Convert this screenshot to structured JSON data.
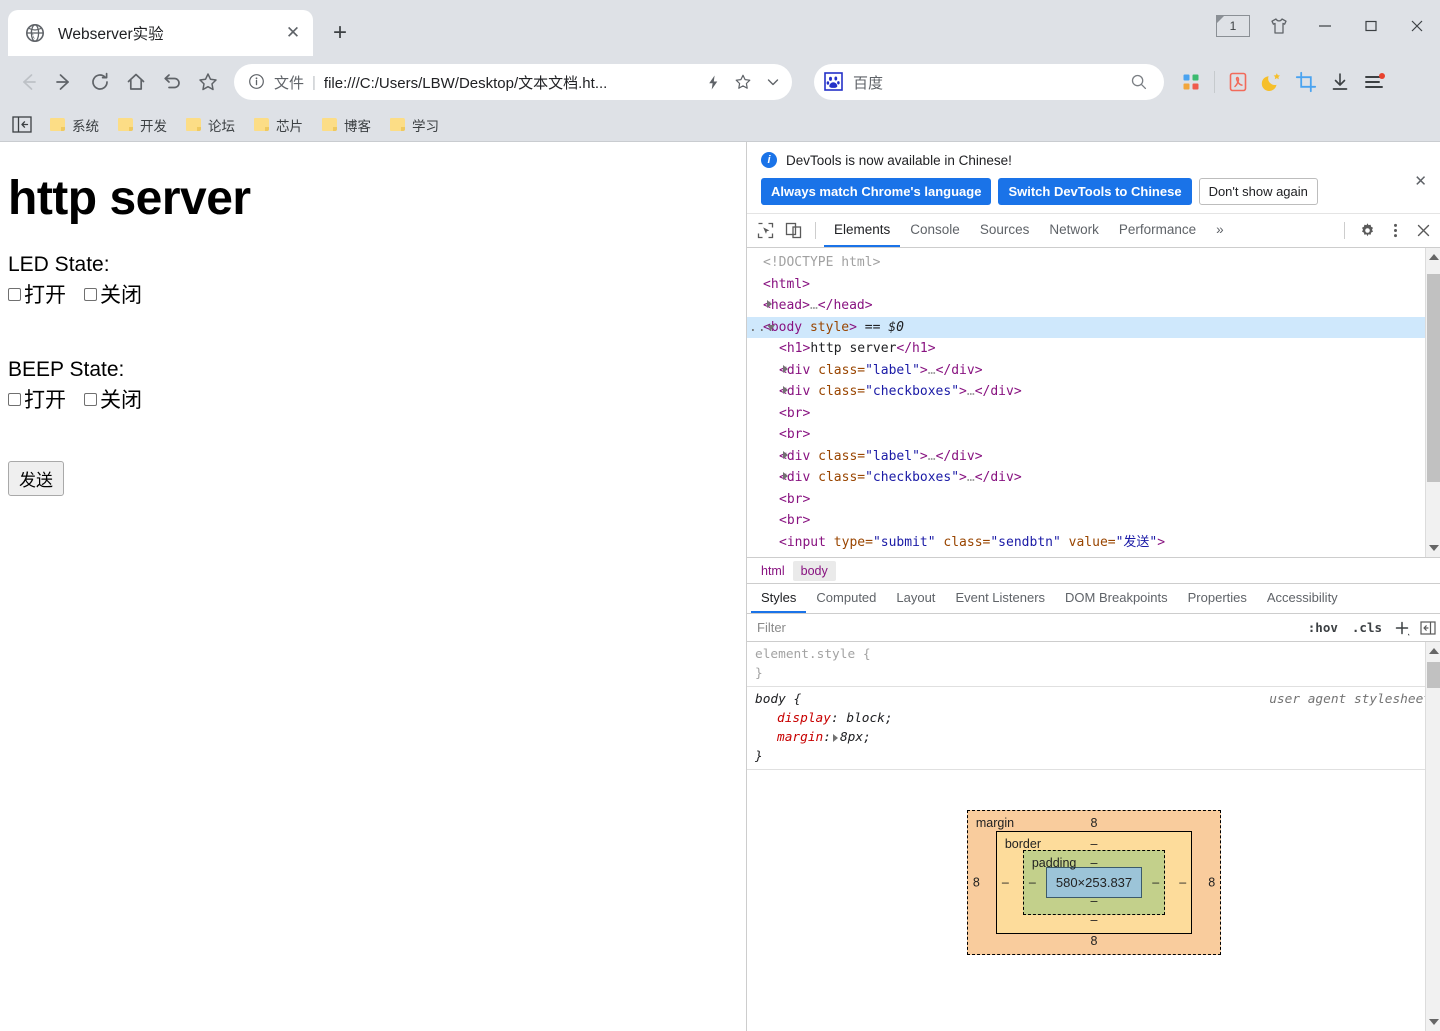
{
  "browser": {
    "tab": {
      "title": "Webserver实验",
      "favicon": "globe-icon",
      "close_label": "✕"
    },
    "newtab_label": "+",
    "window_controls": {
      "tab_count": "1",
      "theme_icon": "tshirt-icon",
      "minimize": "—",
      "maximize": "▢",
      "close": "✕"
    },
    "nav": {
      "back": "←",
      "forward": "→",
      "reload": "⟳",
      "home": "⌂",
      "history_back": "↺",
      "bookmark": "☆"
    },
    "omnibox": {
      "info_icon": "info-circle-icon",
      "scheme_label": "文件",
      "separator": "|",
      "url": "file:///C:/Users/LBW/Desktop/文本文档.ht...",
      "lightning_icon": "lightning-icon",
      "star_icon": "star-icon",
      "chevron_icon": "chevron-down-icon"
    },
    "search": {
      "engine_icon": "baidu-icon",
      "placeholder": "百度",
      "search_icon": "magnifier-icon"
    },
    "extensions": [
      "apps-grid-icon",
      "pdf-icon",
      "moon-star-icon",
      "crop-icon",
      "download-icon",
      "menu-lines-icon"
    ],
    "bookmarks": {
      "panel_toggle": "sidebar-toggle-icon",
      "items": [
        {
          "label": "系统"
        },
        {
          "label": "开发"
        },
        {
          "label": "论坛"
        },
        {
          "label": "芯片"
        },
        {
          "label": "博客"
        },
        {
          "label": "学习"
        }
      ]
    }
  },
  "page": {
    "heading": "http server",
    "groups": [
      {
        "label": "LED State:",
        "options": [
          {
            "label": "打开",
            "checked": false
          },
          {
            "label": "关闭",
            "checked": false
          }
        ]
      },
      {
        "label": "BEEP State:",
        "options": [
          {
            "label": "打开",
            "checked": false
          },
          {
            "label": "关闭",
            "checked": false
          }
        ]
      }
    ],
    "send_button": "发送"
  },
  "devtools": {
    "notice": {
      "icon": "info-icon",
      "message": "DevTools is now available in Chinese!",
      "buttons": [
        {
          "label": "Always match Chrome's language",
          "style": "primary"
        },
        {
          "label": "Switch DevTools to Chinese",
          "style": "primary"
        },
        {
          "label": "Don't show again",
          "style": "ghost"
        }
      ],
      "close": "✕"
    },
    "toolbar": {
      "inspect_icon": "inspect-cursor-icon",
      "device_icon": "device-toolbar-icon",
      "tabs": [
        {
          "label": "Elements",
          "active": true
        },
        {
          "label": "Console",
          "active": false
        },
        {
          "label": "Sources",
          "active": false
        },
        {
          "label": "Network",
          "active": false
        },
        {
          "label": "Performance",
          "active": false
        }
      ],
      "more_tabs": "»",
      "settings_icon": "gear-icon",
      "kebab_icon": "more-vertical-icon",
      "close_icon": "close-icon"
    },
    "dom_tree": [
      {
        "indent": 0,
        "arrow": "none",
        "marker": "",
        "selected": false,
        "parts": [
          {
            "t": "cmt",
            "s": "<!DOCTYPE html>"
          }
        ]
      },
      {
        "indent": 0,
        "arrow": "none",
        "marker": "",
        "selected": false,
        "parts": [
          {
            "t": "tag",
            "s": "<html>"
          }
        ]
      },
      {
        "indent": 0,
        "arrow": "right",
        "marker": "",
        "selected": false,
        "parts": [
          {
            "t": "tag",
            "s": "<head>"
          },
          {
            "t": "cmt",
            "s": "…"
          },
          {
            "t": "tag",
            "s": "</head>"
          }
        ]
      },
      {
        "indent": 0,
        "arrow": "down",
        "marker": "...",
        "selected": true,
        "parts": [
          {
            "t": "tag",
            "s": "<body"
          },
          {
            "t": "attr",
            "s": " style"
          },
          {
            "t": "tag",
            "s": ">"
          },
          {
            "t": "sel0",
            "s": " == $0"
          }
        ]
      },
      {
        "indent": 1,
        "arrow": "none",
        "marker": "",
        "selected": false,
        "parts": [
          {
            "t": "tag",
            "s": "<h1>"
          },
          {
            "t": "txt",
            "s": "http server"
          },
          {
            "t": "tag",
            "s": "</h1>"
          }
        ]
      },
      {
        "indent": 1,
        "arrow": "right",
        "marker": "",
        "selected": false,
        "parts": [
          {
            "t": "tag",
            "s": "<div "
          },
          {
            "t": "attr",
            "s": "class="
          },
          {
            "t": "val",
            "s": "\"label\""
          },
          {
            "t": "tag",
            "s": ">"
          },
          {
            "t": "cmt",
            "s": "…"
          },
          {
            "t": "tag",
            "s": "</div>"
          }
        ]
      },
      {
        "indent": 1,
        "arrow": "right",
        "marker": "",
        "selected": false,
        "parts": [
          {
            "t": "tag",
            "s": "<div "
          },
          {
            "t": "attr",
            "s": "class="
          },
          {
            "t": "val",
            "s": "\"checkboxes\""
          },
          {
            "t": "tag",
            "s": ">"
          },
          {
            "t": "cmt",
            "s": "…"
          },
          {
            "t": "tag",
            "s": "</div>"
          }
        ]
      },
      {
        "indent": 1,
        "arrow": "none",
        "marker": "",
        "selected": false,
        "parts": [
          {
            "t": "tag",
            "s": "<br>"
          }
        ]
      },
      {
        "indent": 1,
        "arrow": "none",
        "marker": "",
        "selected": false,
        "parts": [
          {
            "t": "tag",
            "s": "<br>"
          }
        ]
      },
      {
        "indent": 1,
        "arrow": "right",
        "marker": "",
        "selected": false,
        "parts": [
          {
            "t": "tag",
            "s": "<div "
          },
          {
            "t": "attr",
            "s": "class="
          },
          {
            "t": "val",
            "s": "\"label\""
          },
          {
            "t": "tag",
            "s": ">"
          },
          {
            "t": "cmt",
            "s": "…"
          },
          {
            "t": "tag",
            "s": "</div>"
          }
        ]
      },
      {
        "indent": 1,
        "arrow": "right",
        "marker": "",
        "selected": false,
        "parts": [
          {
            "t": "tag",
            "s": "<div "
          },
          {
            "t": "attr",
            "s": "class="
          },
          {
            "t": "val",
            "s": "\"checkboxes\""
          },
          {
            "t": "tag",
            "s": ">"
          },
          {
            "t": "cmt",
            "s": "…"
          },
          {
            "t": "tag",
            "s": "</div>"
          }
        ]
      },
      {
        "indent": 1,
        "arrow": "none",
        "marker": "",
        "selected": false,
        "parts": [
          {
            "t": "tag",
            "s": "<br>"
          }
        ]
      },
      {
        "indent": 1,
        "arrow": "none",
        "marker": "",
        "selected": false,
        "parts": [
          {
            "t": "tag",
            "s": "<br>"
          }
        ]
      },
      {
        "indent": 1,
        "arrow": "none",
        "marker": "",
        "selected": false,
        "parts": [
          {
            "t": "tag",
            "s": "<input "
          },
          {
            "t": "attr",
            "s": "type="
          },
          {
            "t": "val",
            "s": "\"submit\""
          },
          {
            "t": "attr",
            "s": " class="
          },
          {
            "t": "val",
            "s": "\"sendbtn\""
          },
          {
            "t": "attr",
            "s": " value="
          },
          {
            "t": "val",
            "s": "\"发送\""
          },
          {
            "t": "tag",
            "s": ">"
          }
        ]
      }
    ],
    "breadcrumb": [
      {
        "label": "html",
        "active": false
      },
      {
        "label": "body",
        "active": true
      }
    ],
    "sidebar_tabs": [
      {
        "label": "Styles",
        "active": true
      },
      {
        "label": "Computed",
        "active": false
      },
      {
        "label": "Layout",
        "active": false
      },
      {
        "label": "Event Listeners",
        "active": false
      },
      {
        "label": "DOM Breakpoints",
        "active": false
      },
      {
        "label": "Properties",
        "active": false
      },
      {
        "label": "Accessibility",
        "active": false
      }
    ],
    "filter": {
      "placeholder": "Filter",
      "hov_label": ":hov",
      "cls_label": ".cls",
      "new_rule_label": "+",
      "sidebar_toggle_icon": "panel-toggle-icon"
    },
    "style_rules": [
      {
        "selector": "element.style",
        "origin": "",
        "declarations": []
      },
      {
        "selector": "body",
        "origin": "user agent stylesheet",
        "declarations": [
          {
            "property": "display",
            "value": "block",
            "expandable": false
          },
          {
            "property": "margin",
            "value": "8px",
            "expandable": true
          }
        ]
      }
    ],
    "box_model": {
      "margin_label": "margin",
      "margin_top": "8",
      "margin_right": "8",
      "margin_bottom": "8",
      "margin_left": "8",
      "border_label": "border",
      "border_top": "–",
      "border_right": "–",
      "border_bottom": "–",
      "border_left": "–",
      "padding_label": "padding",
      "padding_top": "–",
      "padding_right": "–",
      "padding_bottom": "–",
      "padding_left": "–",
      "content_size": "580×253.837"
    }
  },
  "colors": {
    "chrome_bg": "#dee1e6",
    "accent_blue": "#1a73e8",
    "selection_blue": "#cfe8fc",
    "margin_orange": "#f9cc9d",
    "border_yellow": "#fddc9b",
    "padding_green": "#c3d08b",
    "content_blue": "#9cc4d8",
    "bookmark_yellow": "#fcdd86"
  }
}
